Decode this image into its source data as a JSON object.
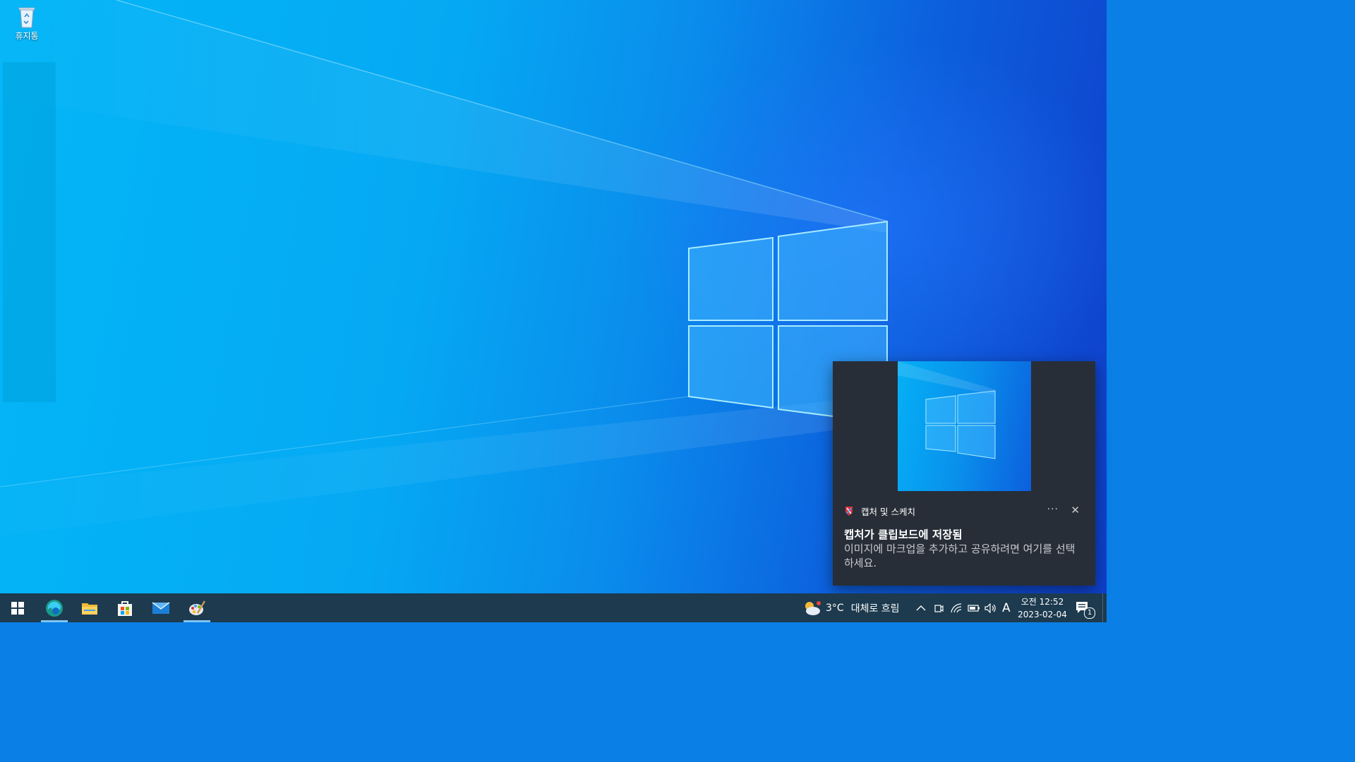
{
  "desktop": {
    "icons": [
      {
        "label": "휴지통",
        "icon": "recycle-bin-icon"
      }
    ]
  },
  "toast": {
    "app_name": "캡처 및 스케치",
    "app_icon": "snip-sketch-icon",
    "more_label": "···",
    "close_label": "✕",
    "title": "캡처가 클립보드에 저장됨",
    "body": "이미지에 마크업을 추가하고 공유하려면 여기를 선택하세요."
  },
  "taskbar": {
    "apps": [
      {
        "name": "start",
        "icon": "windows-start-icon",
        "active": false
      },
      {
        "name": "edge",
        "icon": "edge-icon",
        "active": true
      },
      {
        "name": "file-explorer",
        "icon": "folder-icon",
        "active": false
      },
      {
        "name": "store",
        "icon": "store-icon",
        "active": false
      },
      {
        "name": "mail",
        "icon": "mail-icon",
        "active": false
      },
      {
        "name": "paint",
        "icon": "paint-icon",
        "active": true
      }
    ],
    "weather": {
      "temp": "3°C",
      "condition": "대체로 흐림"
    },
    "tray": {
      "chevron": "^",
      "ime": "A"
    },
    "clock": {
      "time": "오전 12:52",
      "date": "2023-02-04"
    },
    "notifications_count": "1"
  },
  "colors": {
    "taskbar": "#1d3a4e",
    "toast_bg": "#272e38",
    "accent": "#7fc4f4"
  }
}
